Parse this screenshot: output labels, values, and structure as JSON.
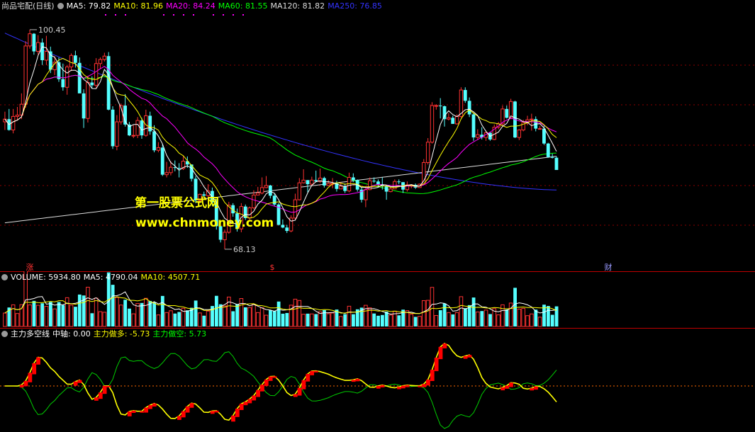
{
  "price_pane": {
    "stock_name": "尚品宅配(日线)",
    "ma_legend": [
      {
        "label": "MA5: 79.82",
        "color": "#ffffff"
      },
      {
        "label": "MA10: 81.96",
        "color": "#ffff00"
      },
      {
        "label": "MA20: 84.24",
        "color": "#ff00ff"
      },
      {
        "label": "MA60: 81.55",
        "color": "#00ff00"
      },
      {
        "label": "MA120: 81.82",
        "color": "#dddddd"
      },
      {
        "label": "MA250: 76.85",
        "color": "#3333ff"
      }
    ],
    "high_label": "100.45",
    "low_label": "68.13",
    "event_markers": [
      "涨",
      "$",
      "财"
    ],
    "watermark_title": "第一股票公式网",
    "watermark_url": "www.chnmoney.com"
  },
  "volume_pane": {
    "legend": [
      {
        "label": "VOLUME: 5934.80",
        "color": "#ffffff"
      },
      {
        "label": "MA5: 4790.04",
        "color": "#ffffff"
      },
      {
        "label": "MA10: 4507.71",
        "color": "#ffff00"
      }
    ]
  },
  "indicator_pane": {
    "legend": [
      {
        "label": "主力多空线",
        "color": "#ffffff"
      },
      {
        "label": "中轴: 0.00",
        "color": "#ffffff"
      },
      {
        "label": "主力做多: -5.73",
        "color": "#ffff00"
      },
      {
        "label": "主力做空: 5.73",
        "color": "#00ff00"
      }
    ]
  },
  "colors": {
    "up": "#ff3232",
    "down": "#54ffff",
    "ma5": "#ffffff",
    "ma10": "#ffff00",
    "ma20": "#ff00ff",
    "ma60": "#00ff00",
    "ma120": "#dddddd",
    "ma250": "#3333ff",
    "grid": "#8b0000",
    "separator": "#c00000",
    "bull_line": "#ffff00",
    "bull_rise": "#ff0000",
    "bear_line": "#00cc00"
  },
  "chart_data": [
    {
      "type": "line",
      "title": "尚品宅配(日线)",
      "candlesticks": {
        "x": [
          1,
          2,
          3,
          4,
          5,
          6,
          7,
          8,
          9,
          10,
          11,
          12,
          13,
          14,
          15,
          16,
          17,
          18,
          19,
          20,
          21,
          22,
          23,
          24,
          25,
          26,
          27,
          28,
          29,
          30,
          31,
          32,
          33,
          34,
          35,
          36,
          37,
          38,
          39,
          40,
          41,
          42,
          43,
          44,
          45,
          46,
          47,
          48,
          49,
          50,
          51,
          52,
          53,
          54,
          55,
          56,
          57,
          58,
          59,
          60,
          61,
          62,
          63,
          64,
          65,
          66,
          67,
          68,
          69,
          70,
          71,
          72,
          73,
          74,
          75,
          76,
          77,
          78,
          79,
          80,
          81,
          82,
          83,
          84,
          85,
          86,
          87,
          88,
          89,
          90,
          91,
          92,
          93,
          94,
          95,
          96,
          97,
          98,
          99,
          100,
          101,
          102,
          103,
          104,
          105,
          106,
          107,
          108,
          109,
          110,
          111,
          112,
          113,
          114,
          115,
          116,
          117,
          118,
          119,
          120,
          121,
          122,
          123,
          124,
          125,
          126,
          127,
          128,
          129,
          130,
          131,
          132,
          133,
          134,
          135,
          136,
          137,
          138,
          139,
          140,
          141,
          142,
          143,
          144,
          145,
          146,
          147,
          148,
          149,
          150,
          151,
          152,
          153,
          154,
          155,
          156,
          157,
          158,
          159,
          160,
          161,
          162,
          163,
          164,
          165,
          166,
          167,
          168,
          169,
          170,
          171,
          172,
          173,
          174,
          175,
          176,
          177,
          178,
          179,
          180
        ],
        "open": [
          86.9,
          87.3,
          85.7,
          87.7,
          87.9,
          89.5,
          98.1,
          99.9,
          97.3,
          98.6,
          96.0,
          97.3,
          94.6,
          95.7,
          93.2,
          92.0,
          95.0,
          96.7,
          95.6,
          91.1,
          87.4,
          92.7,
          92.3,
          95.5,
          96.1,
          96.6,
          88.7,
          83.3,
          86.9,
          89.3,
          86.5,
          84.9,
          84.9,
          87.1,
          84.9,
          87.8,
          85.5,
          82.7,
          83.1,
          79.1,
          79.4,
          80.2,
          80.1,
          80.0,
          81.1,
          80.6,
          78.5,
          75.3,
          76.2,
          76.0,
          76.7,
          75.0,
          71.5,
          69.5,
          70.6,
          74.6,
          73.4,
          71.1,
          74.4,
          72.7,
          74.2,
          76.1,
          76.4,
          77.2,
          77.5,
          76.0,
          74.7,
          71.7,
          71.3,
          70.8,
          72.7,
          75.4,
          77.9,
          78.3,
          77.7,
          78.3,
          78.1,
          78.6,
          77.5,
          77.8,
          77.8,
          77.0,
          77.4,
          76.7,
          78.7,
          78.3,
          76.9,
          75.4,
          76.9,
          78.2,
          78.1,
          77.6,
          77.4,
          76.6,
          77.0,
          78.1,
          78.0,
          76.9,
          77.6,
          77.6,
          77.2,
          77.7,
          80.9,
          83.9,
          89.3,
          89.3,
          89.2,
          87.3,
          87.5,
          86.6,
          87.7,
          91.6,
          90.0,
          88.0,
          84.6,
          85.0,
          84.6,
          85.3,
          84.3,
          86.1,
          86.6,
          88.8,
          87.5,
          89.9,
          84.6,
          85.7,
          86.8,
          87.2,
          87.3,
          85.9,
          85.9,
          83.7,
          81.7,
          81.6
        ],
        "high": [
          88.4,
          88.8,
          88.8,
          89.1,
          91.1,
          98.8,
          100.5,
          100.0,
          99.7,
          99.2,
          99.6,
          98.0,
          96.6,
          96.4,
          95.5,
          95.3,
          97.0,
          97.4,
          96.4,
          91.7,
          93.7,
          93.6,
          96.3,
          96.4,
          97.1,
          97.2,
          89.2,
          87.9,
          89.6,
          91.0,
          86.9,
          86.4,
          87.6,
          87.5,
          88.7,
          88.4,
          86.4,
          83.9,
          83.6,
          81.0,
          81.1,
          81.2,
          80.8,
          81.8,
          81.8,
          80.6,
          78.9,
          76.3,
          76.6,
          77.7,
          77.2,
          75.5,
          71.6,
          71.0,
          75.1,
          74.9,
          74.1,
          74.9,
          74.7,
          74.4,
          76.8,
          77.3,
          78.7,
          78.9,
          77.6,
          76.3,
          74.9,
          72.5,
          71.7,
          73.1,
          76.3,
          78.6,
          79.9,
          78.3,
          78.8,
          79.7,
          80.0,
          78.8,
          78.3,
          78.6,
          78.2,
          78.0,
          77.8,
          79.4,
          79.3,
          78.4,
          77.2,
          77.4,
          78.7,
          78.7,
          78.4,
          78.7,
          77.6,
          77.4,
          78.4,
          78.4,
          78.0,
          78.1,
          77.7,
          77.8,
          77.8,
          81.4,
          84.5,
          89.8,
          89.5,
          90.4,
          89.3,
          88.2,
          87.8,
          88.0,
          92.0,
          92.0,
          90.5,
          88.2,
          85.8,
          86.1,
          85.6,
          85.3,
          86.5,
          86.9,
          89.3,
          89.3,
          90.3,
          90.0,
          85.8,
          87.2,
          87.8,
          88.1,
          87.7,
          86.3,
          86.3,
          83.8,
          82.2,
          81.8
        ],
        "low": [
          85.7,
          85.6,
          85.2,
          87.1,
          87.3,
          89.0,
          97.7,
          96.8,
          96.8,
          95.3,
          95.3,
          94.1,
          93.8,
          92.8,
          91.5,
          90.9,
          94.4,
          94.9,
          91.3,
          86.0,
          86.8,
          91.8,
          91.9,
          94.7,
          95.8,
          88.6,
          82.9,
          82.7,
          86.5,
          86.2,
          84.8,
          84.5,
          84.5,
          84.4,
          84.7,
          85.0,
          82.4,
          82.4,
          78.9,
          78.7,
          79.0,
          79.6,
          78.7,
          79.8,
          80.1,
          78.1,
          74.9,
          74.9,
          75.7,
          75.6,
          74.5,
          71.0,
          69.1,
          68.1,
          70.4,
          72.9,
          70.7,
          70.6,
          72.4,
          72.2,
          74.0,
          76.1,
          76.2,
          77.1,
          75.6,
          74.5,
          71.6,
          71.2,
          70.5,
          70.6,
          72.4,
          75.3,
          77.8,
          76.5,
          77.4,
          78.0,
          77.9,
          77.2,
          77.4,
          77.1,
          76.6,
          77.0,
          76.4,
          76.5,
          78.0,
          76.6,
          75.0,
          74.3,
          76.8,
          77.9,
          77.2,
          76.9,
          75.4,
          76.5,
          77.0,
          77.7,
          76.4,
          76.6,
          77.1,
          77.0,
          77.2,
          77.7,
          80.6,
          83.7,
          88.7,
          87.4,
          86.2,
          87.1,
          86.6,
          86.5,
          87.5,
          89.7,
          87.6,
          84.1,
          84.2,
          84.3,
          84.1,
          84.1,
          84.2,
          85.8,
          86.3,
          87.4,
          87.3,
          84.5,
          84.2,
          85.5,
          86.4,
          85.6,
          85.5,
          85.8,
          83.5,
          81.6,
          81.5,
          80.0
        ],
        "close": [
          87.3,
          85.7,
          87.7,
          87.9,
          89.5,
          98.1,
          99.9,
          97.3,
          98.6,
          96.0,
          97.3,
          94.6,
          95.7,
          93.2,
          92.0,
          95.0,
          96.7,
          95.6,
          91.1,
          87.4,
          92.7,
          92.3,
          95.5,
          96.1,
          96.6,
          88.7,
          83.3,
          86.9,
          89.3,
          86.5,
          84.9,
          84.9,
          87.1,
          84.9,
          87.8,
          85.5,
          82.7,
          83.1,
          79.1,
          79.4,
          80.2,
          80.1,
          80.0,
          81.1,
          80.6,
          78.5,
          75.3,
          76.2,
          76.0,
          76.7,
          75.0,
          71.5,
          69.5,
          70.6,
          74.6,
          73.4,
          71.1,
          74.4,
          72.7,
          74.2,
          76.1,
          76.4,
          77.2,
          77.5,
          76.0,
          74.7,
          71.7,
          71.3,
          70.8,
          72.7,
          75.4,
          77.9,
          78.3,
          77.7,
          78.3,
          78.1,
          78.6,
          77.5,
          77.8,
          77.8,
          77.0,
          77.4,
          76.7,
          78.7,
          78.3,
          76.9,
          75.4,
          76.9,
          78.2,
          78.1,
          77.6,
          77.4,
          76.6,
          77.0,
          78.1,
          78.0,
          76.9,
          77.6,
          77.6,
          77.2,
          77.7,
          80.9,
          83.9,
          89.3,
          89.3,
          89.2,
          87.3,
          87.5,
          86.6,
          87.7,
          91.6,
          90.0,
          88.0,
          84.6,
          85.0,
          84.6,
          85.3,
          84.3,
          86.1,
          86.6,
          88.8,
          87.5,
          89.9,
          84.6,
          85.7,
          86.8,
          87.2,
          87.3,
          85.9,
          85.9,
          83.7,
          81.7,
          81.6,
          79.8
        ]
      },
      "moving_averages_latest": {
        "MA5": 79.82,
        "MA10": 81.96,
        "MA20": 84.24,
        "MA60": 81.55,
        "MA120": 81.82,
        "MA250": 76.85
      },
      "annotations": [
        {
          "label": "100.45",
          "kind": "high"
        },
        {
          "label": "68.13",
          "kind": "low"
        }
      ],
      "ylim": [
        66,
        103
      ]
    },
    {
      "type": "bar",
      "title": "VOLUME",
      "latest": {
        "VOLUME": 5934.8,
        "MA5": 4790.04,
        "MA10": 4507.71
      }
    },
    {
      "type": "line",
      "title": "主力多空线",
      "latest": {
        "中轴": 0.0,
        "主力做多": -5.73,
        "主力做空": 5.73
      }
    }
  ]
}
